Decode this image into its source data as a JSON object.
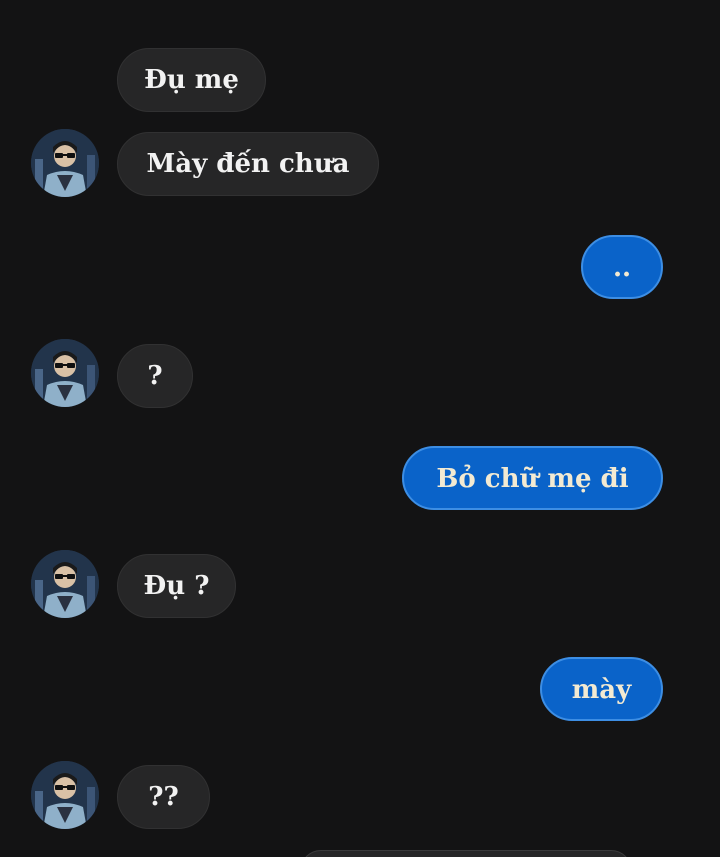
{
  "conversation": {
    "messages": [
      {
        "side": "incoming",
        "text": "Đụ mẹ",
        "has_avatar": false
      },
      {
        "side": "incoming",
        "text": "Mày đến chưa",
        "has_avatar": true
      },
      {
        "side": "outgoing",
        "text": ".."
      },
      {
        "side": "incoming",
        "text": "?",
        "has_avatar": true
      },
      {
        "side": "outgoing",
        "text": "Bỏ chữ mẹ đi"
      },
      {
        "side": "incoming",
        "text": "Đụ ?",
        "has_avatar": true
      },
      {
        "side": "outgoing",
        "text": "mày"
      },
      {
        "side": "incoming",
        "text": "??",
        "has_avatar": true
      }
    ]
  },
  "theme": {
    "background": "#131314",
    "incoming_bubble": "#262627",
    "outgoing_bubble": "#0a63c9",
    "outgoing_border": "#3d8ee4",
    "incoming_text": "#f2f2f2",
    "outgoing_text": "#f3ead2"
  },
  "icons": {
    "sender_avatar": "person-with-sunglasses-avatar"
  }
}
